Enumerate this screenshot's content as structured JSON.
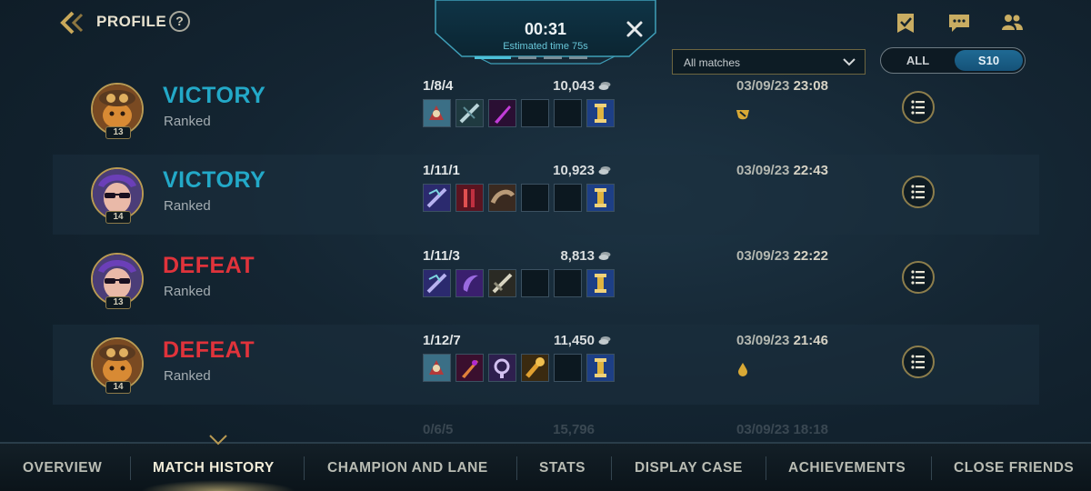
{
  "header": {
    "title": "PROFILE",
    "help_glyph": "?"
  },
  "queue": {
    "time": "00:31",
    "estimate": "Estimated time 75s"
  },
  "filters": {
    "match_filter": "All matches",
    "season_options": [
      "ALL",
      "S10"
    ],
    "season_selected": "S10"
  },
  "matches": [
    {
      "result": "VICTORY",
      "queue_type": "Ranked",
      "level": "13",
      "kda": "1/8/4",
      "gold": "10,043",
      "date": "03/09/23",
      "time": "23:08",
      "medal_icon": "mvp-medal-icon"
    },
    {
      "result": "VICTORY",
      "queue_type": "Ranked",
      "level": "14",
      "kda": "1/11/1",
      "gold": "10,923",
      "date": "03/09/23",
      "time": "22:43"
    },
    {
      "result": "DEFEAT",
      "queue_type": "Ranked",
      "level": "13",
      "kda": "1/11/3",
      "gold": "8,813",
      "date": "03/09/23",
      "time": "22:22"
    },
    {
      "result": "DEFEAT",
      "queue_type": "Ranked",
      "level": "14",
      "kda": "1/12/7",
      "gold": "11,450",
      "date": "03/09/23",
      "time": "21:46",
      "medal_icon": "drop-medal-icon"
    }
  ],
  "partial_match": {
    "kda": "0/6/5",
    "gold": "15,796",
    "datetime": "03/09/23 18:18"
  },
  "nav": {
    "items": [
      "OVERVIEW",
      "MATCH HISTORY",
      "CHAMPION AND LANE",
      "STATS",
      "DISPLAY CASE",
      "ACHIEVEMENTS",
      "CLOSE FRIENDS"
    ],
    "active": "MATCH HISTORY"
  },
  "colors": {
    "victory": "#23a9c8",
    "defeat": "#e0333b",
    "gold_accent": "#b99a53",
    "selected_toggle": "#1f6a94"
  }
}
